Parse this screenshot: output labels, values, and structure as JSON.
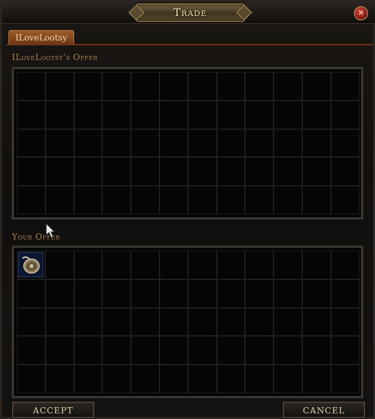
{
  "window": {
    "title": "Trade",
    "close_glyph": "✕"
  },
  "tab": {
    "label": "ILoveLootsy"
  },
  "their_offer": {
    "label": "ILoveLootsy's Offer",
    "columns": 12,
    "rows": 5,
    "items": []
  },
  "your_offer": {
    "label": "Your Offer",
    "columns": 12,
    "rows": 5,
    "items": [
      {
        "name": "amulet-icon"
      }
    ]
  },
  "buttons": {
    "accept": "ACCEPT",
    "cancel": "CANCEL"
  },
  "colors": {
    "tab_accent": "#9d5a2c",
    "section_label": "#b08551",
    "close_button": "#c0392b"
  }
}
